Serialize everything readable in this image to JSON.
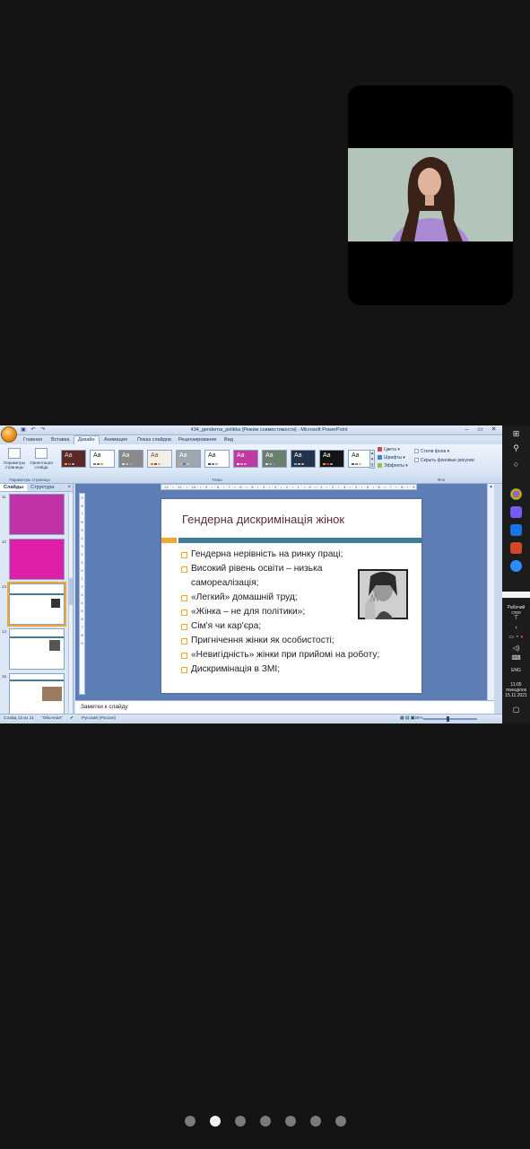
{
  "colors": {
    "background": "#141414",
    "ribbon": "#dce7f5",
    "slide_area": "#5d7fb6",
    "accent_orange": "#f0a830",
    "accent_teal": "#3e7e9a",
    "title_color": "#5a2e38"
  },
  "participant_video": {
    "icon": "camera-feed"
  },
  "powerpoint": {
    "window_title": "434_genderna_politika [Режим совместимости] - Microsoft PowerPoint",
    "tabs": [
      "Главная",
      "Вставка",
      "Дизайн",
      "Анимация",
      "Показ слайдов",
      "Рецензирование",
      "Вид"
    ],
    "active_tab": "Дизайн",
    "ribbon": {
      "page_setup_label": "Параметры страницы",
      "orientation_label": "Ориентация слайда",
      "page_setup_group": "Параметры страницы",
      "themes_group": "Темы",
      "background_group": "Фон",
      "theme_sample": "Aa",
      "colors_label": "Цвета",
      "fonts_label": "Шрифты",
      "effects_label": "Эффекты",
      "bg_styles_label": "Стили фона",
      "hide_bg_label": "Скрыть фоновые рисунки"
    },
    "left_pane": {
      "tab_slides": "Слайды",
      "tab_outline": "Структура",
      "slide_numbers": [
        "11",
        "12",
        "13",
        "14",
        "15"
      ]
    },
    "slide": {
      "title": "Гендерна дискримінація жінок",
      "bullets": [
        "Гендерна нерівність на ринку праці;",
        "Високий рівень освіти – низька",
        "самореалізація;",
        "«Легкий» домашній труд;",
        "«Жінка – не для політики»;",
        "Сім'я чи кар'єра;",
        "Пригнічення жінки як особистості;",
        "«Невигідність» жінки при прийомі на роботу;",
        "Дискримінація в ЗМІ;"
      ]
    },
    "ruler_text": "· 12 · ı · 11 · ı · 10 · ı · 9 · ı · 8 · ı · 7 · ı · 6 · ı · 5 · ı · 4 · ı · 3 · ı · 2 · ı · 1 · ı · 0 · ı · 1 · ı · 2 · ı · 3 · ı · 4 · ı · 5 · ı · 6 · ı · 7 · ı · 8 · ı · 9 · ı · 10 · ı · 11 · ı · 12 ·",
    "notes_placeholder": "Заметки к слайду",
    "status": {
      "slide_info": "Слайд 13 из 21",
      "theme": "\"Обычная\"",
      "language": "Русский (Россия)",
      "zoom": "35%"
    }
  },
  "taskbar": {
    "desktop_label": "Рабочий стол",
    "lang": "ENG",
    "time": "11:05",
    "day": "понеділок",
    "date": "15.11.2021"
  },
  "pager": {
    "count": 7,
    "active_index": 1
  }
}
